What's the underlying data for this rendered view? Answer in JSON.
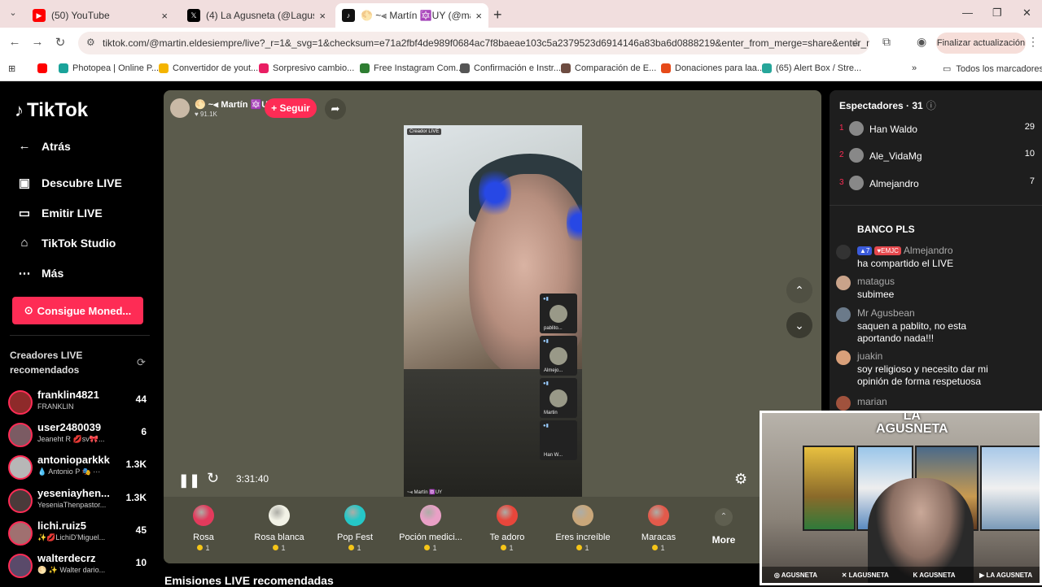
{
  "browser": {
    "tabs": [
      {
        "title": "(50) YouTube",
        "active": false,
        "color": "#ff0000"
      },
      {
        "title": "(4) La Agusneta (@Lagusneta) / X",
        "active": false,
        "color": "#000000"
      },
      {
        "title": "🌕 ~⫷ Martín 🔯UY (@martin.eld...",
        "active": true,
        "color": "#111111"
      }
    ],
    "url": "tiktok.com/@martin.eldesiempre/live?_r=1&_svg=1&checksum=e71a2fbf4de989f0684ac7f8baeae103c5a2379523d6914146a83ba6d0888219&enter_from_merge=share&enter_metho...",
    "update_button": "Finalizar actualización",
    "bookmarks": [
      {
        "label": "Photopea | Online P...",
        "color": "#1aa39a"
      },
      {
        "label": "Convertidor de yout...",
        "color": "#f4b400"
      },
      {
        "label": "Sorpresivo cambio...",
        "color": "#e91e63"
      },
      {
        "label": "Free Instagram Com...",
        "color": "#2e7d32"
      },
      {
        "label": "Confirmación e Instr...",
        "color": "#555555"
      },
      {
        "label": "Comparación de E...",
        "color": "#6d4c41"
      },
      {
        "label": "Donaciones para laa...",
        "color": "#e64a19"
      },
      {
        "label": "(65) Alert Box / Stre...",
        "color": "#26a69a"
      }
    ],
    "all_bookmarks": "Todos los marcadores"
  },
  "sidebar": {
    "logo": "TikTok",
    "nav": [
      {
        "label": "Atrás",
        "icon": "←"
      },
      {
        "label": "Descubre LIVE",
        "icon": "▣"
      },
      {
        "label": "Emitir LIVE",
        "icon": "▭"
      },
      {
        "label": "TikTok Studio",
        "icon": "⌂"
      },
      {
        "label": "Más",
        "icon": "⋯"
      }
    ],
    "coins_button": "Consigue Moned...",
    "creators_header": "Creadores LIVE recomendados",
    "creators": [
      {
        "user": "franklin4821",
        "display": "FRANKLIN",
        "count": "44",
        "color": "#8e2a2a"
      },
      {
        "user": "user2480039",
        "display": "Jeaneht R 💋sv🎀...",
        "count": "6",
        "color": "#7b5b63"
      },
      {
        "user": "antonioparkkk",
        "display": "💧 Antonio P 🎭 ···",
        "count": "1.3K",
        "color": "#b7b7b7"
      },
      {
        "user": "yeseniayhen...",
        "display": "YeseniaThenpastor...",
        "count": "1.3K",
        "color": "#4a3a3a"
      },
      {
        "user": "lichi.ruiz5",
        "display": "✨💋LichiD'Miguel...",
        "count": "45",
        "color": "#a07070"
      },
      {
        "user": "walterdecrz",
        "display": "🌕 ✨ Walter dario...",
        "count": "10",
        "color": "#5a4a6a"
      }
    ]
  },
  "stream": {
    "host_name": "🌕 ~⫷ Martín 🔯UY",
    "host_likes": "♥ 91.1K",
    "follow": "+ Seguir",
    "video_badge": "Creador LIVE",
    "video_caption": "~⫷ Martín 🔯UY",
    "guests": [
      "pablito...",
      "Almejo...",
      "Martin",
      "Han W..."
    ],
    "timer": "3:31:40",
    "gifts": [
      {
        "name": "Rosa",
        "price": "1",
        "color": "#e33a5c"
      },
      {
        "name": "Rosa blanca",
        "price": "1",
        "color": "#f2f2e6"
      },
      {
        "name": "Pop Fest",
        "price": "1",
        "color": "#25c7c7"
      },
      {
        "name": "Poción medici...",
        "price": "1",
        "color": "#e9a0c6"
      },
      {
        "name": "Te adoro",
        "price": "1",
        "color": "#e8463b"
      },
      {
        "name": "Eres increíble",
        "price": "1",
        "color": "#c9a77a"
      },
      {
        "name": "Maracas",
        "price": "1",
        "color": "#e25a4b"
      }
    ],
    "more": "More",
    "recommended": "Emisiones LIVE recomendadas"
  },
  "chat": {
    "viewers_label": "Espectadores · 31",
    "top": [
      {
        "rank": "1",
        "name": "Han Waldo",
        "count": "29"
      },
      {
        "rank": "2",
        "name": "Ale_VidaMg",
        "count": "10"
      },
      {
        "rank": "3",
        "name": "Almejandro",
        "count": "7"
      }
    ],
    "partial_msg": "BANCO PLS",
    "share_badge_level": "▲7",
    "share_badge_fan": "♥EMJC",
    "share_user": "Almejandro",
    "share_text": "ha compartido el LIVE",
    "messages": [
      {
        "user": "matagus",
        "text": "subimee"
      },
      {
        "user": "Mr Agusbean",
        "text": "saquen a pablito, no esta aportando nada!!!"
      },
      {
        "user": "juakin",
        "text": "soy religioso y necesito dar mi opinión de forma respetuosa"
      },
      {
        "user": "marian",
        "text": ""
      }
    ]
  },
  "cam": {
    "logo_line1": "LA",
    "logo_line2": "AGUSNETA",
    "socials": [
      "◎ AGUSNETA",
      "✕ LAGUSNETA",
      "K AGUSNETA",
      "▶ LA AGUSNETA"
    ]
  }
}
